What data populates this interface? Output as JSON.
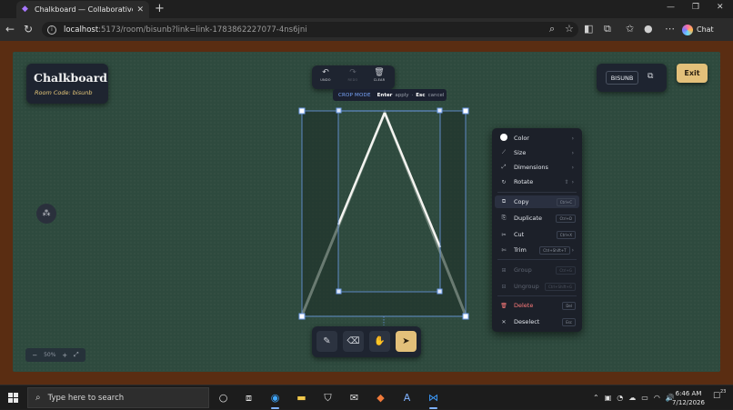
{
  "browser": {
    "tab_title": "Chalkboard — Collaborative Real-",
    "url_host": "localhost",
    "url_path": ":5173/room/bisunb?link=link-1783862227077-4ns6jni",
    "profile_label": "Chat"
  },
  "app": {
    "brand_title": "Chalkboard",
    "room_code_label": "Room Code: bisunb",
    "room_code_badge": "BISUNB",
    "exit_label": "Exit",
    "zoom_minus": "−",
    "zoom_level": "50%",
    "zoom_plus": "+",
    "zoom_fit": "⤢",
    "colors": {
      "board": "#2e4a3e",
      "frame": "#5a2d12",
      "accent": "#e3c07a",
      "selection": "#5b8ee6"
    }
  },
  "top_toolbar": {
    "undo_label": "UNDO",
    "redo_label": "REDO",
    "clear_label": "CLEAR"
  },
  "crop_mode": {
    "mode": "CROP MODE",
    "key1": "Enter",
    "key1_desc": "apply",
    "sep": "·",
    "key2": "Esc",
    "key2_desc": "cancel"
  },
  "dock": {
    "tools": [
      "pen-tool",
      "eraser-tool",
      "hand-tool",
      "select-tool"
    ],
    "active": "select-tool"
  },
  "context_menu": {
    "items": [
      {
        "label": "Color",
        "icon": "color-swatch",
        "submenu": true
      },
      {
        "label": "Size",
        "icon": "size-icon",
        "submenu": true
      },
      {
        "label": "Dimensions",
        "icon": "dimensions-icon",
        "submenu": true
      },
      {
        "label": "Rotate",
        "icon": "rotate-icon",
        "shortcut": "⇧",
        "submenu": true
      },
      {
        "label": "Copy",
        "icon": "copy-icon",
        "shortcut": "Ctrl+C"
      },
      {
        "label": "Duplicate",
        "icon": "duplicate-icon",
        "shortcut": "Ctrl+D"
      },
      {
        "label": "Cut",
        "icon": "cut-icon",
        "shortcut": "Ctrl+X"
      },
      {
        "label": "Trim",
        "icon": "trim-icon",
        "shortcut": "Ctrl+Shift+T",
        "submenu": true
      },
      {
        "label": "Group",
        "icon": "group-icon",
        "shortcut": "Ctrl+G",
        "disabled": true
      },
      {
        "label": "Ungroup",
        "icon": "ungroup-icon",
        "shortcut": "Ctrl+Shift+G",
        "disabled": true
      },
      {
        "label": "Delete",
        "icon": "delete-icon",
        "shortcut": "Del"
      },
      {
        "label": "Deselect",
        "icon": "deselect-icon",
        "shortcut": "Esc"
      }
    ]
  },
  "taskbar": {
    "search_placeholder": "Type here to search",
    "time": "6:46 AM",
    "date": "7/12/2026",
    "notification_count": "23"
  }
}
